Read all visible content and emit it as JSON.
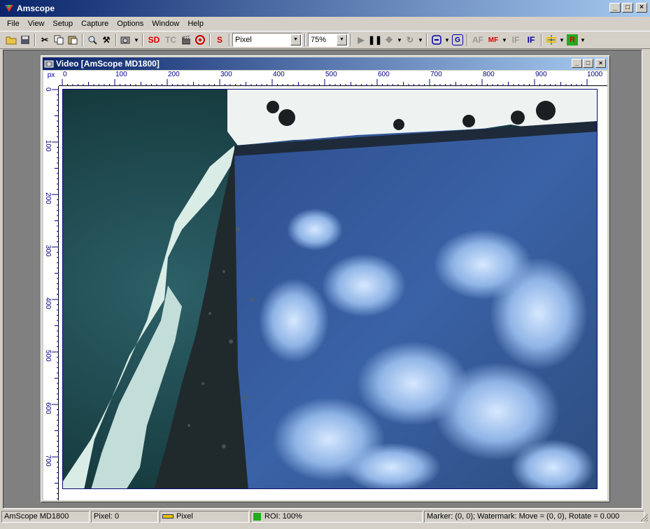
{
  "app": {
    "title": "Amscope"
  },
  "window_buttons": {
    "minimize": "_",
    "maximize": "□",
    "close": "×"
  },
  "menu": [
    "File",
    "View",
    "Setup",
    "Capture",
    "Options",
    "Window",
    "Help"
  ],
  "toolbar": {
    "sd_label": "SD",
    "tc_label": "TC",
    "s_label": "S",
    "unit_select": "Pixel",
    "zoom_select": "75%",
    "af_label": "AF",
    "mf_label": "MF",
    "if_label": "IF",
    "if2_label": "IF",
    "g_label": "G",
    "r_label": "R"
  },
  "video_window": {
    "title": "Video [AmScope MD1800]",
    "ruler_unit": "px",
    "h_ticks": [
      "0",
      "100",
      "200",
      "300",
      "400",
      "500",
      "600",
      "700",
      "800",
      "900",
      "1000"
    ],
    "v_ticks": [
      "0",
      "100",
      "200",
      "300",
      "400",
      "500",
      "600",
      "700"
    ]
  },
  "status": {
    "device": "AmScope MD1800",
    "pixel": "Pixel: 0",
    "unit": "Pixel",
    "roi": "ROI: 100%",
    "marker": "Marker: (0, 0); Watermark: Move = (0, 0), Rotate = 0.000"
  },
  "colors": {
    "title_start": "#0a246a",
    "title_end": "#a6caf0",
    "ruler_text": "#000080"
  }
}
